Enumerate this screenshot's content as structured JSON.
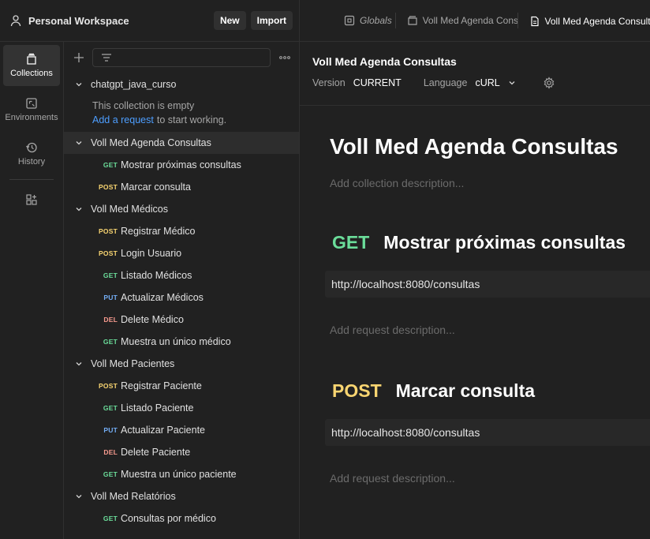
{
  "workspace": {
    "title": "Personal Workspace",
    "new_label": "New",
    "import_label": "Import"
  },
  "tabs": [
    {
      "label": "Globals"
    },
    {
      "label": "Voll Med Agenda Consul"
    },
    {
      "label": "Voll Med Agenda Consultas"
    }
  ],
  "rail": [
    {
      "label": "Collections",
      "icon": "collections-icon",
      "active": true
    },
    {
      "label": "Environments",
      "icon": "environments-icon"
    },
    {
      "label": "History",
      "icon": "history-icon"
    }
  ],
  "tree": {
    "filter_placeholder": "",
    "empty_text": "This collection is empty",
    "empty_link": "Add a request",
    "empty_suffix": "to start working.",
    "folders": [
      {
        "name": "chatgpt_java_curso",
        "requests": []
      },
      {
        "name": "Voll Med Agenda Consultas",
        "requests": [
          {
            "method": "GET",
            "name": "Mostrar próximas consultas"
          },
          {
            "method": "POST",
            "name": "Marcar consulta"
          }
        ]
      },
      {
        "name": "Voll Med Médicos",
        "requests": [
          {
            "method": "POST",
            "name": "Registrar Médico"
          },
          {
            "method": "POST",
            "name": "Login Usuario"
          },
          {
            "method": "GET",
            "name": "Listado Médicos"
          },
          {
            "method": "PUT",
            "name": "Actualizar Médicos"
          },
          {
            "method": "DEL",
            "name": "Delete Médico"
          },
          {
            "method": "GET",
            "name": "Muestra un único médico"
          }
        ]
      },
      {
        "name": "Voll Med Pacientes",
        "requests": [
          {
            "method": "POST",
            "name": "Registrar Paciente"
          },
          {
            "method": "GET",
            "name": "Listado Paciente"
          },
          {
            "method": "PUT",
            "name": "Actualizar Paciente"
          },
          {
            "method": "DEL",
            "name": "Delete Paciente"
          },
          {
            "method": "GET",
            "name": "Muestra un único paciente"
          }
        ]
      },
      {
        "name": "Voll Med Relatórios",
        "requests": [
          {
            "method": "GET",
            "name": "Consultas por médico"
          }
        ]
      }
    ]
  },
  "doc": {
    "header_title": "Voll Med Agenda Consultas",
    "version_label": "Version",
    "version_value": "CURRENT",
    "language_label": "Language",
    "language_value": "cURL",
    "title": "Voll Med Agenda Consultas",
    "description_placeholder": "Add collection description...",
    "requests": [
      {
        "method": "GET",
        "name": "Mostrar próximas consultas",
        "url": "http://localhost:8080/consultas",
        "desc_placeholder": "Add request description..."
      },
      {
        "method": "POST",
        "name": "Marcar consulta",
        "url": "http://localhost:8080/consultas",
        "desc_placeholder": "Add request description..."
      }
    ]
  },
  "colors": {
    "get": "#6bdd9a",
    "post": "#f9d571",
    "put": "#74aef6",
    "del": "#f79a8e",
    "link": "#4d9eff"
  }
}
